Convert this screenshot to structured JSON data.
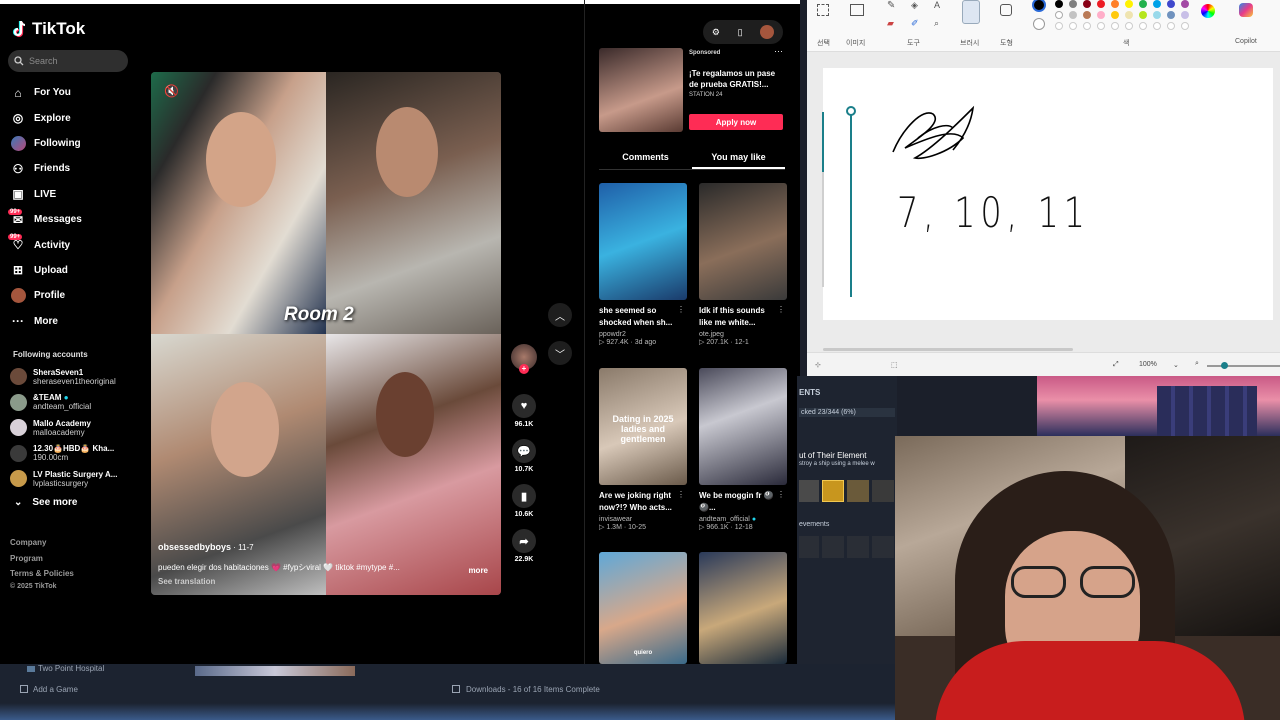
{
  "tiktok": {
    "brand": "TikTok",
    "search_placeholder": "Search",
    "nav": [
      {
        "label": "For You",
        "icon": "home-icon"
      },
      {
        "label": "Explore",
        "icon": "compass-icon"
      },
      {
        "label": "Following",
        "icon": "following-icon"
      },
      {
        "label": "Friends",
        "icon": "friends-icon"
      },
      {
        "label": "LIVE",
        "icon": "live-icon"
      },
      {
        "label": "Messages",
        "icon": "messages-icon",
        "badge": "99+"
      },
      {
        "label": "Activity",
        "icon": "activity-icon",
        "badge": "99+"
      },
      {
        "label": "Upload",
        "icon": "upload-icon"
      },
      {
        "label": "Profile",
        "icon": "profile-icon"
      },
      {
        "label": "More",
        "icon": "more-icon"
      }
    ],
    "following_header": "Following accounts",
    "following": [
      {
        "name": "SheraSeven1",
        "handle": "sheraseven1theoriginal",
        "color": "#6b4a3a"
      },
      {
        "name": "&TEAM",
        "handle": "andteam_official",
        "color": "#8a9a8a"
      },
      {
        "name": "Mallo Academy",
        "handle": "malloacademy",
        "color": "#d8d0d8"
      },
      {
        "name": "12.30🎂HBD🎂 Kha...",
        "handle": "190.00cm",
        "color": "#3a3a3a"
      },
      {
        "name": "LV Plastic Surgery A...",
        "handle": "lvplasticsurgery",
        "color": "#c79a4a"
      }
    ],
    "see_more": "See more",
    "footer": [
      "Company",
      "Program",
      "Terms & Policies"
    ],
    "copyright": "© 2025 TikTok",
    "video": {
      "overlay_text": "Room 2",
      "username": "obsessedbyboys",
      "date": "· 11-7",
      "caption": "pueden elegir dos habitaciones 💗 #fypシviral 🤍 tiktok #mytype #...",
      "more": "more",
      "translate": "See translation"
    },
    "actions": {
      "likes": "96.1K",
      "comments": "10.7K",
      "saves": "10.6K",
      "shares": "22.9K"
    },
    "ad": {
      "sponsored": "Sponsored",
      "title": "¡Te regalamos un pase de prueba GRATIS!...",
      "station": "STATION 24",
      "cta": "Apply now"
    },
    "tabs": [
      "Comments",
      "You may like"
    ],
    "cards": [
      {
        "title": "she seemed so shocked when sh...",
        "user": "ppowdr2",
        "views": "927.4K",
        "date": "3d ago",
        "overlay": "",
        "bg": "linear-gradient(160deg,#1f5fa8,#3ab2e0 50%,#1a3a6a)"
      },
      {
        "title": "Idk if this sounds like me white...",
        "user": "ote.jpeg",
        "views": "207.1K",
        "date": "12-1",
        "overlay": "",
        "bg": "linear-gradient(160deg,#2a2a2a,#8a6e5a 55%,#3a3a3a)"
      },
      {
        "title": "Are we joking right now?!? Who acts...",
        "user": "invisawear",
        "views": "1.3M",
        "date": "10-25",
        "overlay": "Dating in 2025 ladies and gentlemen",
        "bg": "linear-gradient(160deg,#8a7a6a,#d8c8b8 55%,#6a5a4a)"
      },
      {
        "title": "We be moggin fr 🎱🎱...",
        "user": "andteam_official",
        "views": "966.1K",
        "date": "12-18",
        "overlay": "",
        "bg": "linear-gradient(160deg,#4a4a5a,#c8c8d0 40%,#2a2a3a)"
      },
      {
        "title": "",
        "user": "",
        "views": "",
        "date": "",
        "overlay": "quiero",
        "bg": "linear-gradient(160deg,#5fa8d8,#d8a88a 55%,#3a6a8a)"
      },
      {
        "title": "",
        "user": "",
        "views": "",
        "date": "",
        "overlay": "",
        "bg": "linear-gradient(160deg,#2a3a5a,#c8a87a 55%,#1a2a3a)"
      }
    ]
  },
  "paint": {
    "groups": [
      "선택",
      "이미지",
      "도구",
      "브러시",
      "도형",
      "색",
      "Copilot"
    ],
    "zoom": "100%",
    "palette": [
      "#000000",
      "#7f7f7f",
      "#880015",
      "#ed1c24",
      "#ff7f27",
      "#fff200",
      "#22b14c",
      "#00a2e8",
      "#3f48cc",
      "#a349a4",
      "#ffffff",
      "#c3c3c3",
      "#b97a57",
      "#ffaec9",
      "#ffc90e",
      "#efe4b0",
      "#b5e61d",
      "#99d9ea",
      "#7092be",
      "#c8bfe7"
    ],
    "drawing_text": "7, 10, 11"
  },
  "steam": {
    "header": "ENTS",
    "progress": "cked 23/344 (6%)",
    "achievement_title": "ut of Their Element",
    "achievement_desc": "stroy a ship using a melee w",
    "section": "evements"
  },
  "taskbar": {
    "game_title": "Two Point Hospital",
    "add_game": "Add a Game",
    "downloads": "Downloads - 16 of 16 Items Complete"
  }
}
